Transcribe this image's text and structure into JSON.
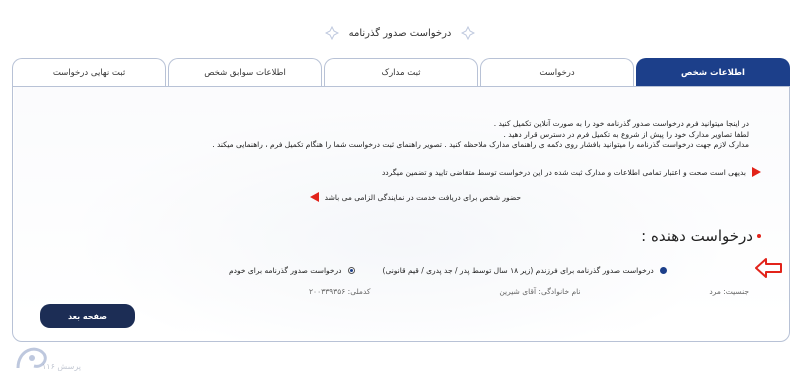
{
  "page": {
    "title": "درخواست صدور گذرنامه"
  },
  "tabs": [
    {
      "label": "اطلاعات شخص",
      "active": true
    },
    {
      "label": "درخواست",
      "active": false
    },
    {
      "label": "ثبت مدارک",
      "active": false
    },
    {
      "label": "اطلاعات سوابق شخص",
      "active": false
    },
    {
      "label": "ثبت نهایی درخواست",
      "active": false
    }
  ],
  "info": {
    "line1": "در اینجا میتوانید فرم درخواست صدور گذرنامه خود را به صورت آنلاین تکمیل کنید .",
    "line2": "لطفا تصاویر مدارک خود را پیش از شروع به تکمیل فرم در دسترس قرار دهید .",
    "line3": "مدارک لازم جهت درخواست گذرنامه را میتوانید بافشار روی دکمه ی راهنمای مدارک ملاحظه کنید . تصویر راهنمای ثبت درخواست شما را هنگام تکمیل فرم ، راهنمایی میکند ."
  },
  "bullets": {
    "b1": "بدیهی است صحت و اعتبار تمامی اطلاعات و مدارک ثبت شده در این درخواست توسط متقاضی تایید و تضمین میگردد",
    "b2": "حضور شخص برای دریافت خدمت در نمایندگی الزامی می باشد"
  },
  "applicant": {
    "heading": "درخواست دهنده :",
    "options": [
      {
        "label": "درخواست صدور گذرنامه برای خودم",
        "selected": true
      },
      {
        "label": "درخواست صدور گذرنامه برای فرزندم (زیر ۱۸ سال توسط پدر / جد پدری / قیم قانونی)",
        "selected": false
      }
    ]
  },
  "details": {
    "national_code": "کدملی: ۲۰۰۳۳۹۳۵۶",
    "family_name": "نام خانوادگی: آقای شیرین",
    "gender": "جنسیت: مرد"
  },
  "buttons": {
    "next": "صفحه بعد"
  },
  "logo_text": "پرسش ۱۱۶",
  "colors": {
    "primary": "#1c3f8a",
    "button_dark": "#1c2d55",
    "accent_red": "#e2231a",
    "border": "#b8c2d6"
  }
}
